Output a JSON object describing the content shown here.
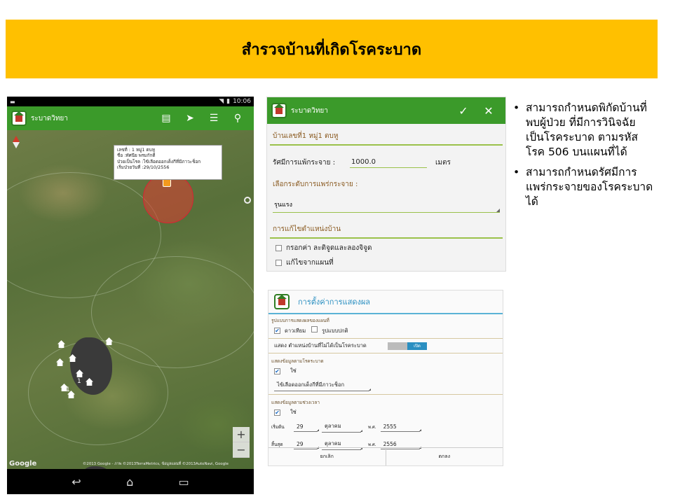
{
  "slide": {
    "title": "สำรวจบ้านที่เกิดโรคระบาด"
  },
  "phone": {
    "status_time": "10:06",
    "app_name": "ระบาดวิทยา",
    "popup": {
      "line1": "เลขที่ : 1 หมู่1 ตบหู",
      "line2": "ชื่อ :ทัศนีย พรมกักดี",
      "line3": "ป่วยเป็นโรค :ไข้เลือดออกเด็งกีที่มีภาวะช็อก",
      "line4": "เริ่มป่วยวันที่ :29/10/2556"
    },
    "cluster_count_a": "1",
    "cluster_count_b": "1",
    "zoom_in": "+",
    "zoom_out": "−",
    "google": "Google",
    "attribution": "©2013 Google - ภาพ ©2013TerraMetrics, ข้อมูลแผนที่ ©2013AutoNavi, Google"
  },
  "panel1": {
    "app_name": "ระบาดวิทยา",
    "confirm_icon": "check-icon",
    "close_icon": "close-icon",
    "house_label": "บ้านเลขที่1 หมู่1 ตบหู",
    "radius_label": "รัศมีการแพ้กระจาย :",
    "radius_value": "1000.0",
    "radius_unit": "เมตร",
    "spread_label": "เลือกระดับการแพร่กระจาย :",
    "spread_value": "รุนแรง",
    "edit_header": "การแก้ไขตำแหน่งบ้าน",
    "option1": "กรอกค่า ละติจูดและลองจิจูด",
    "option2": "แก้ไขจากแผนที่"
  },
  "panel2": {
    "title": "การตั้งค่าการแสดงผล",
    "map_type_label": "รูปแบบการแสดงผลของแผนที่",
    "satellite": "ดาวเทียม",
    "normal": "รูปแบบปกติ",
    "show_nonepidemic": "แสดง ตำแหน่งบ้านที่ไม่ได้เป็นโรคระบาด",
    "toggle_on": "เปิด",
    "by_disease_label": "แสดงข้อมูลตามโรคระบาด",
    "yes1": "ใช่",
    "disease_value": "ไข้เลือดออกเด็งกีที่มีภาวะช็อก",
    "by_time_label": "แสดงข้อมูลตามช่วงเวลา",
    "yes2": "ใช่",
    "start_label": "เริ่มต้น",
    "start_day": "29",
    "start_month": "ตุลาคม",
    "start_era": "พ.ศ.",
    "start_year": "2555",
    "end_label": "สิ้นสุด",
    "end_day": "29",
    "end_month": "ตุลาคม",
    "end_era": "พ.ศ.",
    "end_year": "2556",
    "cancel": "ยกเลิก",
    "ok": "ตกลง"
  },
  "bullets": [
    "สามารถกำหนดพิกัดบ้านที่พบผู้ป่วย ที่มีการวินิจฉัยเป็นโรคระบาด ตามรหัสโรค 506 บนแผนที่ได้",
    "สามารถกำหนดรัศมีการแพร่กระจายของโรคระบาดได้"
  ],
  "colors": {
    "title_bar": "#ffc000",
    "app_green": "#3b9a2a",
    "accent_blue": "#2a8fc1"
  }
}
